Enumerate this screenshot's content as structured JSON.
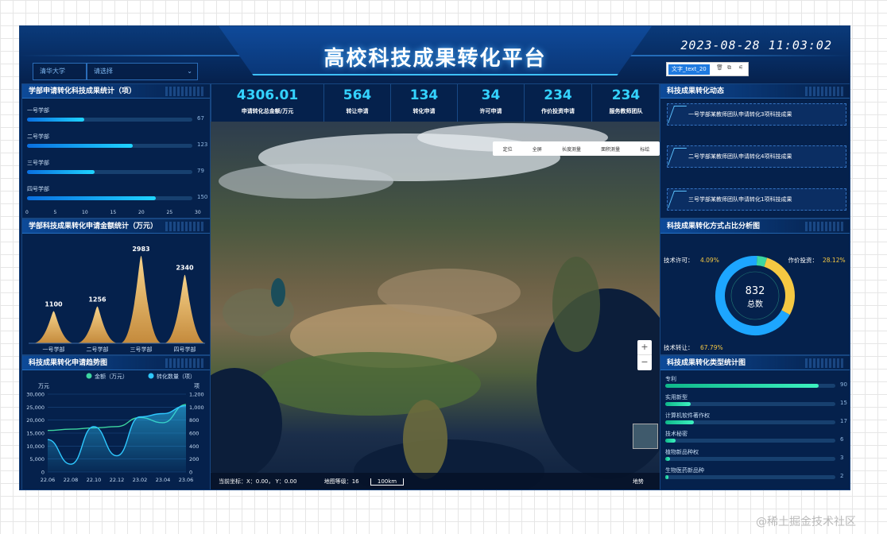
{
  "header": {
    "title": "高校科技成果转化平台",
    "datetime": "2023-08-28 11:03:02",
    "university_select": "清华大学",
    "dept_select_placeholder": "请选择"
  },
  "dept_projects": {
    "title": "学部申请转化科技成果统计（项）",
    "rows": [
      {
        "label": "一号学部",
        "value": 67
      },
      {
        "label": "二号学部",
        "value": 123
      },
      {
        "label": "三号学部",
        "value": 79
      },
      {
        "label": "四号学部",
        "value": 150
      }
    ],
    "ticks": [
      "0",
      "5",
      "10",
      "15",
      "20",
      "25",
      "30"
    ]
  },
  "stats": [
    {
      "value": "4306.01",
      "label": "申请转化总金额/万元"
    },
    {
      "value": "564",
      "label": "转让申请"
    },
    {
      "value": "134",
      "label": "转化申请"
    },
    {
      "value": "34",
      "label": "许可申请"
    },
    {
      "value": "234",
      "label": "作价投资申请"
    },
    {
      "value": "234",
      "label": "服务教师团队"
    }
  ],
  "map": {
    "toolbar": [
      "定位",
      "全屏",
      "长度测量",
      "面积测量",
      "标绘"
    ],
    "status_coord": "当前坐标：X：0.00， Y：0.00",
    "status_level": "地图等级：16",
    "scale": "100km",
    "credit": "地势",
    "zoom_in": "+",
    "zoom_out": "−"
  },
  "right_top": {
    "title": "科技成果转化动态",
    "editor_tag": "文字_text_20",
    "items": [
      "一号学部某教师团队申请转化3项科技成果",
      "二号学部某教师团队申请转化4项科技成果",
      "三号学部某教师团队申请转化1项科技成果"
    ]
  },
  "amount_chart": {
    "title": "学部科技成果转化申请金额统计（万元）",
    "chart_data": {
      "type": "bar",
      "categories": [
        "一号学部",
        "二号学部",
        "三号学部",
        "四号学部"
      ],
      "values": [
        1100,
        1256,
        2983,
        2340
      ],
      "title": "学部科技成果转化申请金额统计（万元）"
    }
  },
  "trend_chart": {
    "title": "科技成果转化申请趋势图",
    "legend": [
      "金额（万元）",
      "转化数量（项）"
    ],
    "left_unit": "万元",
    "right_unit": "项",
    "chart_data": {
      "type": "line",
      "x": [
        "22.06",
        "22.08",
        "22.10",
        "22.12",
        "23.02",
        "23.04",
        "23.06"
      ],
      "y_left_ticks": [
        "30,000",
        "25,000",
        "20,000",
        "15,000",
        "10,000",
        "5,000",
        "0"
      ],
      "y_right_ticks": [
        "1,200",
        "1,000",
        "800",
        "600",
        "400",
        "200",
        "0"
      ],
      "ylim_left": [
        0,
        30000
      ],
      "ylim_right": [
        0,
        1200
      ],
      "series": [
        {
          "name": "金额（万元）",
          "axis": "left",
          "values": [
            16000,
            16500,
            17000,
            17500,
            21000,
            19000,
            26000
          ],
          "color": "#3dd6a0"
        },
        {
          "name": "转化数量（项）",
          "axis": "right",
          "values": [
            500,
            120,
            700,
            250,
            850,
            900,
            1020
          ],
          "color": "#2ec8ff"
        }
      ]
    }
  },
  "ratio_chart": {
    "title": "科技成果转化方式占比分析图",
    "center_value": "832",
    "center_label": "总数",
    "chart_data": {
      "type": "pie",
      "categories": [
        "技术许可",
        "作价投资",
        "技术转让"
      ],
      "values": [
        4.09,
        28.12,
        67.79
      ],
      "labels": [
        "4.09%",
        "28.12%",
        "67.79%"
      ],
      "colors": [
        "#3dd6a0",
        "#f5c842",
        "#1da6ff"
      ]
    }
  },
  "type_chart": {
    "title": "科技成果转化类型统计图",
    "chart_data": {
      "type": "bar",
      "categories": [
        "专利",
        "实用新型",
        "计算机软件著作权",
        "技术秘密",
        "植物新品种权",
        "生物医药新品种"
      ],
      "values": [
        90,
        15,
        17,
        6,
        3,
        2
      ],
      "xlim": [
        0,
        100
      ]
    }
  },
  "watermark": "@稀土掘金技术社区"
}
